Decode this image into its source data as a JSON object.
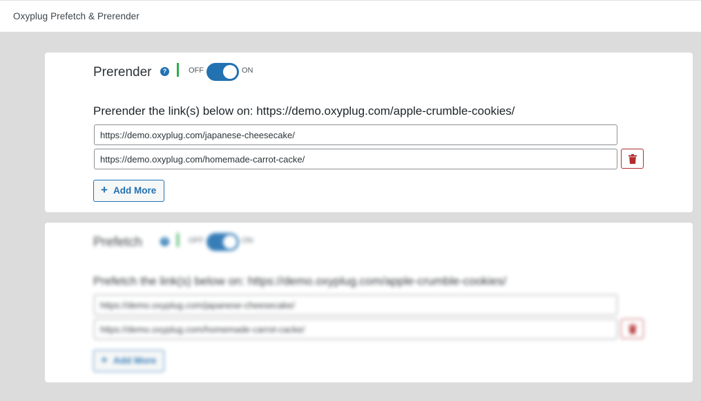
{
  "header": {
    "title": "Oxyplug Prefetch & Prerender"
  },
  "prerender": {
    "title": "Prerender",
    "help_icon": "?",
    "toggle_off_label": "OFF",
    "toggle_on_label": "ON",
    "toggle_state": "on",
    "subtitle": "Prerender the link(s) below on: https://demo.oxyplug.com/apple-crumble-cookies/",
    "links": [
      "https://demo.oxyplug.com/japanese-cheesecake/",
      "https://demo.oxyplug.com/homemade-carrot-cacke/"
    ],
    "add_more_label": "Add More"
  },
  "prefetch": {
    "title": "Prefetch",
    "help_icon": "?",
    "toggle_off_label": "OFF",
    "toggle_on_label": "ON",
    "toggle_state": "on",
    "subtitle": "Prefetch the link(s) below on: https://demo.oxyplug.com/apple-crumble-cookies/",
    "links": [
      "https://demo.oxyplug.com/japanese-cheesecake/",
      "https://demo.oxyplug.com/homemade-carrot-cacke/"
    ],
    "add_more_label": "Add More"
  },
  "colors": {
    "accent": "#2271b1",
    "danger": "#b32d2e",
    "success": "#2bab4f",
    "background": "#dcdcdc"
  },
  "icons": {
    "help": "question-circle-icon",
    "delete": "trash-icon",
    "add": "plus-icon"
  }
}
